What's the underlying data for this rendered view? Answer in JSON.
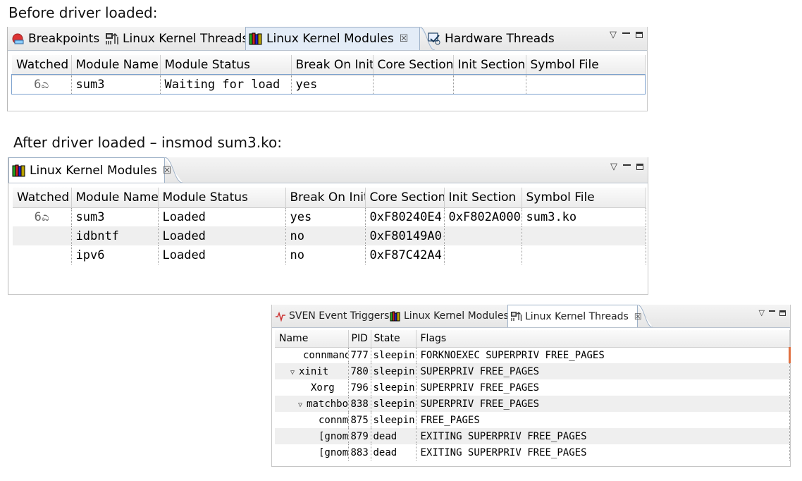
{
  "captions": {
    "before": "Before driver loaded:",
    "after": "After driver loaded – insmod sum3.ko:"
  },
  "icons": {
    "breakpoints": "breakpoint-stop-icon",
    "threads": "kernel-threads-icon",
    "modules": "kernel-modules-books-icon",
    "hardware_threads": "hardware-threads-icon",
    "sven": "sven-event-icon",
    "watched": "glasses-icon"
  },
  "colors": {
    "tab_active": "#e3ecf7",
    "row_alt": "#efefef",
    "accent_mark": "#e07040"
  },
  "panel1": {
    "tabs": [
      {
        "label": "Breakpoints"
      },
      {
        "label": "Linux Kernel Threads"
      },
      {
        "label": "Linux Kernel Modules",
        "close": "☒"
      },
      {
        "label": "Hardware Threads"
      }
    ],
    "columns": [
      "Watched",
      "Module Name",
      "Module Status",
      "Break On Init",
      "Core Section",
      "Init Section",
      "Symbol File"
    ],
    "rows": [
      {
        "watched": "6ಎ",
        "name": "sum3",
        "status": "Waiting for load",
        "break": "yes",
        "core": "",
        "init": "",
        "symbol": ""
      }
    ]
  },
  "panel2": {
    "tabs": [
      {
        "label": "Linux Kernel Modules",
        "close": "☒"
      }
    ],
    "columns": [
      "Watched",
      "Module Name",
      "Module Status",
      "Break On Init",
      "Core Section",
      "Init Section",
      "Symbol File"
    ],
    "rows": [
      {
        "watched": "6ಎ",
        "name": "sum3",
        "status": "Loaded",
        "break": "yes",
        "core": "0xF80240E4-",
        "init": "0xF802A000-",
        "symbol": "sum3.ko"
      },
      {
        "watched": "",
        "name": "idbntf",
        "status": "Loaded",
        "break": "no",
        "core": "0xF80149A0-",
        "init": "",
        "symbol": ""
      },
      {
        "watched": "",
        "name": "ipv6",
        "status": "Loaded",
        "break": "no",
        "core": "0xF87C42A4-",
        "init": "",
        "symbol": ""
      }
    ]
  },
  "panel3": {
    "tabs": [
      {
        "label": "SVEN Event Triggers"
      },
      {
        "label": "Linux Kernel Modules"
      },
      {
        "label": "Linux Kernel Threads",
        "close": "☒"
      }
    ],
    "columns": [
      "Name",
      "PID",
      "State",
      "Flags"
    ],
    "rows": [
      {
        "name": "connmand",
        "pid": "777",
        "state": "sleepin",
        "flags": "FORKNOEXEC SUPERPRIV FREE_PAGES"
      },
      {
        "name": "xinit",
        "pid": "780",
        "state": "sleepin",
        "flags": "SUPERPRIV FREE_PAGES",
        "twisty": "▽"
      },
      {
        "name": "Xorg",
        "pid": "796",
        "state": "sleepin",
        "flags": "SUPERPRIV FREE_PAGES"
      },
      {
        "name": "matchbo",
        "pid": "838",
        "state": "sleepin",
        "flags": "SUPERPRIV FREE_PAGES",
        "twisty": "▽"
      },
      {
        "name": "connm",
        "pid": "875",
        "state": "sleepin",
        "flags": "FREE_PAGES"
      },
      {
        "name": "[gnom",
        "pid": "879",
        "state": "dead",
        "flags": "EXITING SUPERPRIV FREE_PAGES"
      },
      {
        "name": "[gnom",
        "pid": "883",
        "state": "dead",
        "flags": "EXITING SUPERPRIV FREE_PAGES"
      }
    ]
  }
}
